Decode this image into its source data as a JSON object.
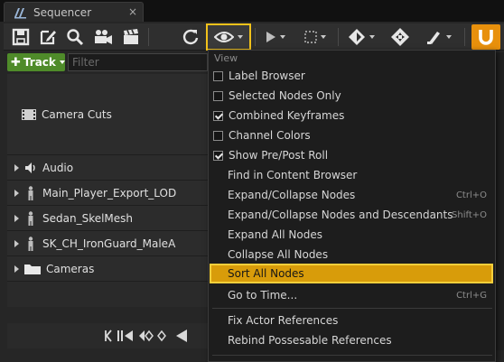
{
  "window": {
    "tab_title": "Sequencer",
    "close_glyph": "×"
  },
  "toolbar": {
    "buttons": [
      "save-icon",
      "save-as-icon",
      "find-icon",
      "camera-icon",
      "clapper-icon",
      "restore-icon",
      "view-eye-icon",
      "play-icon",
      "selection-icon",
      "keyframe-icon",
      "transform-icon",
      "paint-icon",
      "magnet-icon"
    ],
    "accent_color": "#f2c21b",
    "magnet_color": "#e8900c"
  },
  "track_bar": {
    "add_label": "Track",
    "filter_placeholder": "Filter"
  },
  "tree": {
    "camera_cuts": "Camera Cuts",
    "rows": [
      {
        "label": "Audio",
        "icon": "speaker-icon"
      },
      {
        "label": "Main_Player_Export_LOD",
        "icon": "actor-icon"
      },
      {
        "label": "Sedan_SkelMesh",
        "icon": "actor-icon"
      },
      {
        "label": "SK_CH_IronGuard_MaleA",
        "icon": "actor-icon"
      },
      {
        "label": "Cameras",
        "icon": "folder-icon"
      }
    ]
  },
  "menu": {
    "heading": "View",
    "items": [
      {
        "label": "Label Browser",
        "checkbox": true,
        "checked": false
      },
      {
        "label": "Selected Nodes Only",
        "checkbox": true,
        "checked": false
      },
      {
        "label": "Combined Keyframes",
        "checkbox": true,
        "checked": true
      },
      {
        "label": "Channel Colors",
        "checkbox": true,
        "checked": false
      },
      {
        "label": "Show Pre/Post Roll",
        "checkbox": true,
        "checked": true
      },
      {
        "label": "Find in Content Browser"
      },
      {
        "label": "Expand/Collapse Nodes",
        "shortcut": "Ctrl+O"
      },
      {
        "label": "Expand/Collapse Nodes and Descendants",
        "shortcut": "Shift+O"
      },
      {
        "label": "Expand All Nodes"
      },
      {
        "label": "Collapse All Nodes"
      },
      {
        "label": "Sort All Nodes",
        "highlighted": true
      },
      {
        "label": "Go to Time...",
        "shortcut": "Ctrl+G"
      },
      {
        "label": "Fix Actor References"
      },
      {
        "label": "Rebind Possesable References"
      }
    ],
    "highlight_color": "#d89c0a"
  }
}
